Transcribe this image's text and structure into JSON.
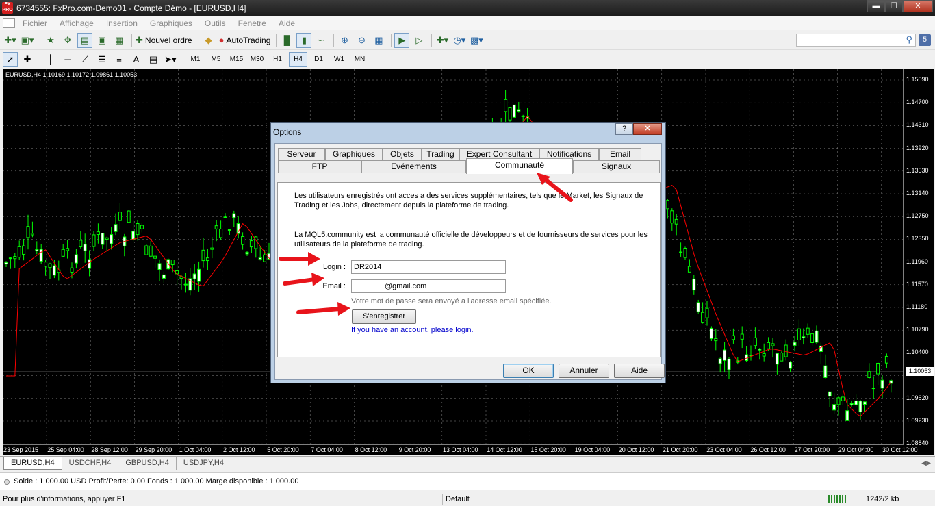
{
  "window": {
    "title": "6734555: FxPro.com-Demo01 - Compte Démo - [EURUSD,H4]",
    "icon_label": "FX PRO",
    "controls": [
      "minimize-icon",
      "restore-icon",
      "close-icon"
    ]
  },
  "menu": [
    "Fichier",
    "Affichage",
    "Insertion",
    "Graphiques",
    "Outils",
    "Fenetre",
    "Aide"
  ],
  "toolbar": {
    "new_order": "Nouvel ordre",
    "autotrading": "AutoTrading",
    "timeframes": [
      "M1",
      "M5",
      "M15",
      "M30",
      "H1",
      "H4",
      "D1",
      "W1",
      "MN"
    ],
    "active_timeframe": "H4",
    "search_placeholder": "",
    "badge": "5"
  },
  "chart": {
    "header": "EURUSD,H4  1.10169 1.10172 1.09861 1.10053",
    "price_labels": [
      "1.15090",
      "1.14700",
      "1.14310",
      "1.13920",
      "1.13530",
      "1.13140",
      "1.12750",
      "1.12350",
      "1.11960",
      "1.11570",
      "1.11180",
      "1.10790",
      "1.10400",
      "1.10053",
      "1.09620",
      "1.09230",
      "1.08840"
    ],
    "current_price": "1.10053",
    "date_labels": [
      "23 Sep 2015",
      "25 Sep 04:00",
      "28 Sep 12:00",
      "29 Sep 20:00",
      "1 Oct 04:00",
      "2 Oct 12:00",
      "5 Oct 20:00",
      "7 Oct 04:00",
      "8 Oct 12:00",
      "9 Oct 20:00",
      "13 Oct 04:00",
      "14 Oct 12:00",
      "15 Oct 20:00",
      "19 Oct 04:00",
      "20 Oct 12:00",
      "21 Oct 20:00",
      "23 Oct 04:00",
      "26 Oct 12:00",
      "27 Oct 20:00",
      "29 Oct 04:00",
      "30 Oct 12:00"
    ],
    "candle_color": "#00ff00",
    "ma_color": "#ff0000"
  },
  "chart_tabs": [
    "EURUSD,H4",
    "USDCHF,H4",
    "GBPUSD,H4",
    "USDJPY,H4"
  ],
  "account": "Solde : 1 000.00 USD  Profit/Perte: 0.00  Fonds : 1 000.00  Marge disponible : 1 000.00",
  "status": {
    "help": "Pour plus d'informations, appuyer F1",
    "profile": "Default",
    "traffic": "1242/2 kb"
  },
  "dialog": {
    "title": "Options",
    "help_btn": "?",
    "tabs_row1": [
      "Serveur",
      "Graphiques",
      "Objets",
      "Trading",
      "Expert Consultant",
      "Notifications",
      "Email"
    ],
    "tabs_row2": [
      "FTP",
      "Evénements",
      "Communauté",
      "Signaux"
    ],
    "active_tab": "Communauté",
    "text1_line1": "Les utilisateurs enregistrés ont acces a des services supplémentaires, tels que le Market, les Signaux de",
    "text1_line2": "Trading et les Jobs, directement depuis la plateforme de trading.",
    "text2_line1": "La MQL5.community est la communauté officielle de développeurs et de fournisseurs de services pour les",
    "text2_line2": "utilisateurs de la plateforme de trading.",
    "login_label": "Login :",
    "login_value": "DR2014",
    "email_label": "Email :",
    "email_value": "@gmail.com",
    "hint": "Votre mot de passe sera envoyé a l'adresse email spécifiée.",
    "register": "S'enregistrer",
    "login_link": "If you have an account, please login.",
    "ok": "OK",
    "cancel": "Annuler",
    "help": "Aide"
  },
  "annotation_color": "#e8141b"
}
